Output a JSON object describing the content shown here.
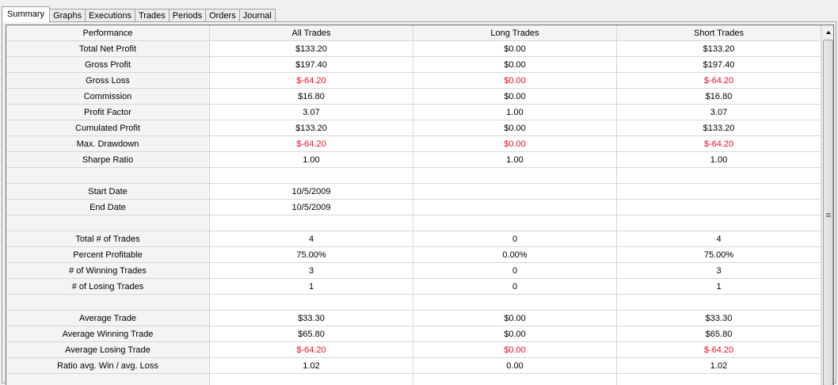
{
  "tabs": [
    "Summary",
    "Graphs",
    "Executions",
    "Trades",
    "Periods",
    "Orders",
    "Journal"
  ],
  "active_tab": "Summary",
  "columns": [
    "Performance",
    "All Trades",
    "Long Trades",
    "Short Trades"
  ],
  "colors": {
    "negative": "#e81123",
    "gridline": "#d6d6d6",
    "header_bg": "#f4f4f4"
  },
  "rows": [
    {
      "label": "Total Net Profit",
      "all": "$133.20",
      "long": "$0.00",
      "short": "$133.20",
      "negative": false
    },
    {
      "label": "Gross Profit",
      "all": "$197.40",
      "long": "$0.00",
      "short": "$197.40",
      "negative": false
    },
    {
      "label": "Gross Loss",
      "all": "$-64.20",
      "long": "$0.00",
      "short": "$-64.20",
      "negative": true
    },
    {
      "label": "Commission",
      "all": "$16.80",
      "long": "$0.00",
      "short": "$16.80",
      "negative": false
    },
    {
      "label": "Profit Factor",
      "all": "3.07",
      "long": "1.00",
      "short": "3.07",
      "negative": false
    },
    {
      "label": "Cumulated Profit",
      "all": "$133.20",
      "long": "$0.00",
      "short": "$133.20",
      "negative": false
    },
    {
      "label": "Max. Drawdown",
      "all": "$-64.20",
      "long": "$0.00",
      "short": "$-64.20",
      "negative": true
    },
    {
      "label": "Sharpe Ratio",
      "all": "1.00",
      "long": "1.00",
      "short": "1.00",
      "negative": false
    },
    {
      "label": "",
      "all": "",
      "long": "",
      "short": "",
      "negative": false
    },
    {
      "label": "Start Date",
      "all": "10/5/2009",
      "long": "",
      "short": "",
      "negative": false
    },
    {
      "label": "End Date",
      "all": "10/5/2009",
      "long": "",
      "short": "",
      "negative": false
    },
    {
      "label": "",
      "all": "",
      "long": "",
      "short": "",
      "negative": false
    },
    {
      "label": "Total # of Trades",
      "all": "4",
      "long": "0",
      "short": "4",
      "negative": false
    },
    {
      "label": "Percent Profitable",
      "all": "75.00%",
      "long": "0.00%",
      "short": "75.00%",
      "negative": false
    },
    {
      "label": "# of Winning Trades",
      "all": "3",
      "long": "0",
      "short": "3",
      "negative": false
    },
    {
      "label": "# of Losing Trades",
      "all": "1",
      "long": "0",
      "short": "1",
      "negative": false
    },
    {
      "label": "",
      "all": "",
      "long": "",
      "short": "",
      "negative": false
    },
    {
      "label": "Average Trade",
      "all": "$33.30",
      "long": "$0.00",
      "short": "$33.30",
      "negative": false
    },
    {
      "label": "Average Winning Trade",
      "all": "$65.80",
      "long": "$0.00",
      "short": "$65.80",
      "negative": false
    },
    {
      "label": "Average Losing Trade",
      "all": "$-64.20",
      "long": "$0.00",
      "short": "$-64.20",
      "negative": true
    },
    {
      "label": "Ratio avg. Win / avg. Loss",
      "all": "1.02",
      "long": "0.00",
      "short": "1.02",
      "negative": false
    },
    {
      "label": "",
      "all": "",
      "long": "",
      "short": "",
      "negative": false
    }
  ]
}
